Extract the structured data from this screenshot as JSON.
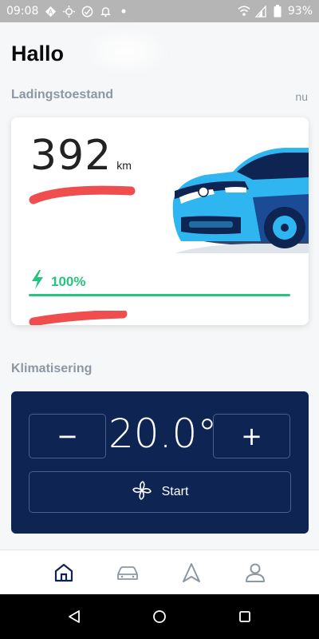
{
  "status_bar": {
    "time": "09:08",
    "battery": "93%"
  },
  "greeting": "Hallo",
  "charging": {
    "title": "Ladingstoestand",
    "updated": "nu",
    "range_value": "392",
    "range_unit": "km",
    "charge_percent": "100%",
    "charge_level": 1.0
  },
  "climate": {
    "title": "Klimatisering",
    "temperature": "20.0°",
    "minus_label": "−",
    "plus_label": "+",
    "start_label": "Start"
  },
  "bottom_nav": {
    "items": [
      "home-icon",
      "car-icon",
      "navigation-icon",
      "profile-icon"
    ]
  },
  "colors": {
    "accent_green": "#27c481",
    "climate_bg": "#0e2452",
    "car_blue": "#2fb6f0",
    "car_dark": "#0e2452",
    "redaction": "#f04e4e"
  }
}
